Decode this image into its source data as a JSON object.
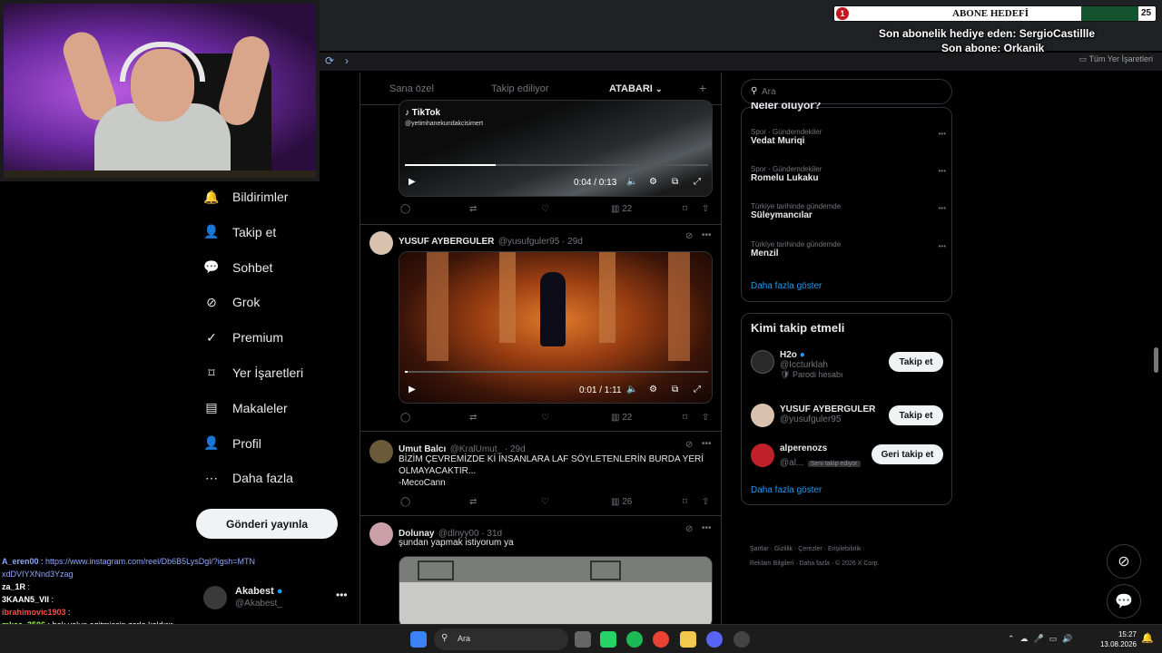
{
  "overlay": {
    "subgoal_number": "1",
    "subgoal_title": "ABONE HEDEFİ",
    "subgoal_count": "25",
    "last_gift": "Son abonelik hediye eden: SergioCastillle",
    "last_sub": "Son abone: Orkanik"
  },
  "browser": {
    "bookmark_label": "Tüm Yer İşaretleri"
  },
  "nav": {
    "items": [
      {
        "label": "Bildirimler",
        "icon": "bell-icon"
      },
      {
        "label": "Takip et",
        "icon": "add-person-icon"
      },
      {
        "label": "Sohbet",
        "icon": "chat-icon"
      },
      {
        "label": "Grok",
        "icon": "grok-icon"
      },
      {
        "label": "Premium",
        "icon": "verified-icon"
      },
      {
        "label": "Yer İşaretleri",
        "icon": "bookmark-icon"
      },
      {
        "label": "Makaleler",
        "icon": "article-icon"
      },
      {
        "label": "Profil",
        "icon": "person-icon"
      },
      {
        "label": "Daha fazla",
        "icon": "more-circle-icon"
      }
    ],
    "post_button": "Gönderi yayınla",
    "account_name": "Akabest",
    "account_handle": "@Akabest_"
  },
  "chat": [
    {
      "user": "A_eren00",
      "text": "https://www.instagram.com/reel/Db6B5LysDgl/?igsh=MTNxdDVIYXNnd3Yzag",
      "user_color": "#8fa8ff",
      "text_color": "#8fa8ff"
    },
    {
      "user": "za_1R",
      "text": "",
      "user_color": "#ffffff",
      "text_color": "#ffffff"
    },
    {
      "user": "3KAAN5_VII",
      "text": "",
      "user_color": "#ffffff",
      "text_color": "#ffffff"
    },
    {
      "user": "ibrahimovic1903",
      "text": "",
      "user_color": "#ff4b4b",
      "text_color": "#ffffff"
    },
    {
      "user": "mkaa_3506",
      "text": "bok yolun agitmişsin zorla kaldırır",
      "user_color": "#9dff4b",
      "text_color": "#ffffff"
    }
  ],
  "feed": {
    "tabs": [
      "Sana özel",
      "Takip ediliyor",
      "ATABARI"
    ],
    "active_tab": "ATABARI",
    "tweets": [
      {
        "source_label": "TikTok",
        "source_handle": "@yetimhanekundakcisimert",
        "time": "0:04 / 0:13",
        "progress": 0.3,
        "views": "22"
      },
      {
        "name": "YUSUF AYBERGULER",
        "handle": "@yusufguler95 · 29d",
        "time": "0:01 / 1:11",
        "progress": 0.01,
        "views": "22"
      },
      {
        "name": "Umut Balcı",
        "handle": "@KralUmut_ · 29d",
        "text_lines": [
          "BİZİM ÇEVREMİZDE Kİ İNSANLARA LAF SÖYLETENLERİN BURDA YERİ",
          "OLMAYACAKTIR...",
          "-MecoCann"
        ],
        "views": "26"
      },
      {
        "name": "Dolunay",
        "handle": "@dlnyy00 · 31d",
        "text": "şundan yapmak istiyorum ya"
      }
    ]
  },
  "right": {
    "search_placeholder": "Ara",
    "trends_title": "Neler oluyor?",
    "trends": [
      {
        "meta": "Spor · Gündemdekiler",
        "name": "Vedat Muriqi"
      },
      {
        "meta": "Spor · Gündemdekiler",
        "name": "Romelu Lukaku"
      },
      {
        "meta": "Türkiye tarihinde gündemde",
        "name": "Süleymancılar"
      },
      {
        "meta": "Türkiye tarihinde gündemde",
        "name": "Menzil"
      }
    ],
    "show_more": "Daha fazla göster",
    "who_title": "Kimi takip etmeli",
    "suggestions": [
      {
        "name": "H2o",
        "handle": "@Iccturklah",
        "sub": "Parodi hesabı",
        "button": "Takip et"
      },
      {
        "name": "YUSUF AYBERGULER",
        "handle": "@yusufguler95",
        "sub": "",
        "button": "Takip et"
      },
      {
        "name": "alperenozs",
        "handle": "@al...",
        "sub": "Seni takip ediyor",
        "button": "Geri takip et"
      }
    ],
    "show_more_2": "Daha fazla göster",
    "footer_line1": "Şartlar  ·  Gizlilik  ·  Çerezler  ·  Erişilebilirlik  ·",
    "footer_line2": "Reklam Bilgileri  ·  Daha fazla  ·  © 2026 X Corp."
  },
  "taskbar": {
    "search_label": "Ara",
    "time": "15:27",
    "date": "13.08.2026"
  }
}
